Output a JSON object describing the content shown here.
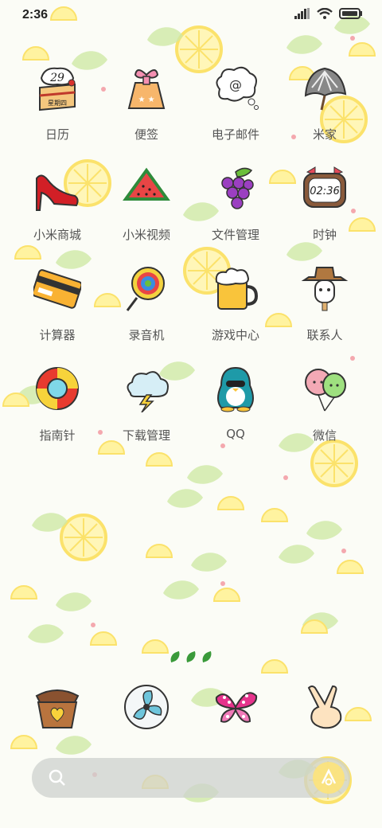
{
  "status": {
    "time": "2:36"
  },
  "apps": [
    {
      "label": "日历",
      "icon": "calendar-cake-icon",
      "day": "29",
      "weekday": "星期四"
    },
    {
      "label": "便签",
      "icon": "notes-gift-icon"
    },
    {
      "label": "电子邮件",
      "icon": "email-cloud-icon"
    },
    {
      "label": "米家",
      "icon": "mijia-shell-icon"
    },
    {
      "label": "小米商城",
      "icon": "high-heel-icon"
    },
    {
      "label": "小米视频",
      "icon": "watermelon-icon"
    },
    {
      "label": "文件管理",
      "icon": "grapes-icon"
    },
    {
      "label": "时钟",
      "icon": "alarm-clock-icon",
      "clock_text": "02:36"
    },
    {
      "label": "计算器",
      "icon": "card-icon"
    },
    {
      "label": "录音机",
      "icon": "lollipop-icon"
    },
    {
      "label": "游戏中心",
      "icon": "beer-mug-icon"
    },
    {
      "label": "联系人",
      "icon": "popsicle-hat-icon"
    },
    {
      "label": "指南针",
      "icon": "life-ring-icon"
    },
    {
      "label": "下载管理",
      "icon": "storm-cloud-icon"
    },
    {
      "label": "QQ",
      "icon": "qq-penguin-icon"
    },
    {
      "label": "微信",
      "icon": "balloons-icon"
    }
  ],
  "dock": [
    {
      "icon": "telephone-icon"
    },
    {
      "icon": "fan-icon"
    },
    {
      "icon": "butterfly-icon"
    },
    {
      "icon": "victory-hand-icon"
    }
  ],
  "colors": {
    "lemon": "#fbe26b",
    "leaf": "#b9e28c",
    "label": "#555555"
  }
}
